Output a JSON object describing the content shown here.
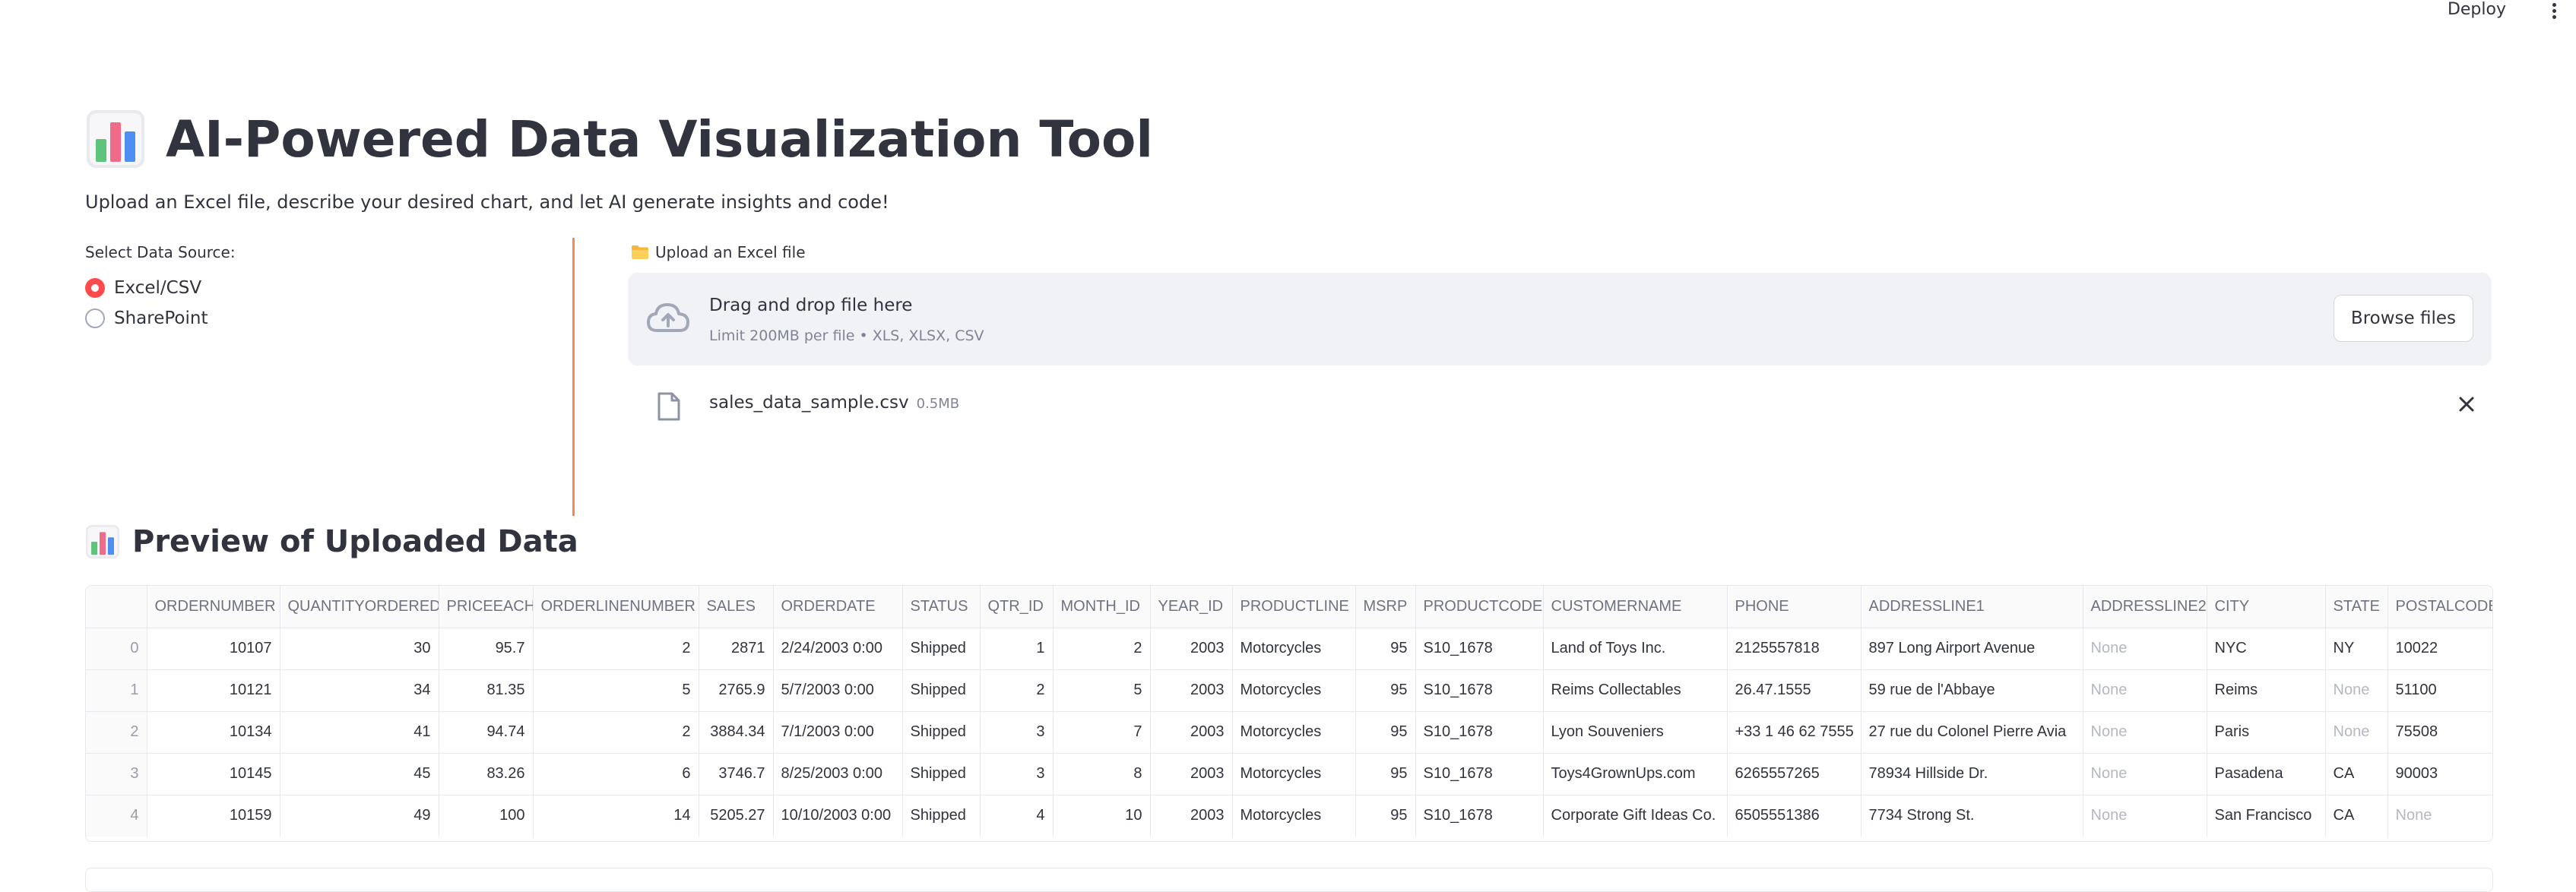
{
  "header": {
    "deploy_label": "Deploy"
  },
  "page": {
    "title": "AI-Powered Data Visualization Tool",
    "subtitle": "Upload an Excel file, describe your desired chart, and let AI generate insights and code!"
  },
  "data_source": {
    "label": "Select Data Source:",
    "options": [
      {
        "label": "Excel/CSV",
        "selected": true
      },
      {
        "label": "SharePoint",
        "selected": false
      }
    ]
  },
  "uploader": {
    "label": "Upload an Excel file",
    "drop_title": "Drag and drop file here",
    "drop_limit": "Limit 200MB per file • XLS, XLSX, CSV",
    "browse_label": "Browse files",
    "file": {
      "name": "sales_data_sample.csv",
      "size": "0.5MB"
    }
  },
  "preview": {
    "title": "Preview of Uploaded Data",
    "columns": [
      "",
      "ORDERNUMBER",
      "QUANTITYORDERED",
      "PRICEEACH",
      "ORDERLINENUMBER",
      "SALES",
      "ORDERDATE",
      "STATUS",
      "QTR_ID",
      "MONTH_ID",
      "YEAR_ID",
      "PRODUCTLINE",
      "MSRP",
      "PRODUCTCODE",
      "CUSTOMERNAME",
      "PHONE",
      "ADDRESSLINE1",
      "ADDRESSLINE2",
      "CITY",
      "STATE",
      "POSTALCODE"
    ],
    "rows": [
      [
        "0",
        "10107",
        "30",
        "95.7",
        "2",
        "2871",
        "2/24/2003 0:00",
        "Shipped",
        "1",
        "2",
        "2003",
        "Motorcycles",
        "95",
        "S10_1678",
        "Land of Toys Inc.",
        "2125557818",
        "897 Long Airport Avenue",
        "None",
        "NYC",
        "NY",
        "10022"
      ],
      [
        "1",
        "10121",
        "34",
        "81.35",
        "5",
        "2765.9",
        "5/7/2003 0:00",
        "Shipped",
        "2",
        "5",
        "2003",
        "Motorcycles",
        "95",
        "S10_1678",
        "Reims Collectables",
        "26.47.1555",
        "59 rue de l'Abbaye",
        "None",
        "Reims",
        "None",
        "51100"
      ],
      [
        "2",
        "10134",
        "41",
        "94.74",
        "2",
        "3884.34",
        "7/1/2003 0:00",
        "Shipped",
        "3",
        "7",
        "2003",
        "Motorcycles",
        "95",
        "S10_1678",
        "Lyon Souveniers",
        "+33 1 46 62 7555",
        "27 rue du Colonel Pierre Avia",
        "None",
        "Paris",
        "None",
        "75508"
      ],
      [
        "3",
        "10145",
        "45",
        "83.26",
        "6",
        "3746.7",
        "8/25/2003 0:00",
        "Shipped",
        "3",
        "8",
        "2003",
        "Motorcycles",
        "95",
        "S10_1678",
        "Toys4GrownUps.com",
        "6265557265",
        "78934 Hillside Dr.",
        "None",
        "Pasadena",
        "CA",
        "90003"
      ],
      [
        "4",
        "10159",
        "49",
        "100",
        "14",
        "5205.27",
        "10/10/2003 0:00",
        "Shipped",
        "4",
        "10",
        "2003",
        "Motorcycles",
        "95",
        "S10_1678",
        "Corporate Gift Ideas Co.",
        "6505551386",
        "7734 Strong St.",
        "None",
        "San Francisco",
        "CA",
        "None"
      ]
    ],
    "numeric_columns": [
      0,
      1,
      2,
      3,
      4,
      5,
      8,
      9,
      10,
      12
    ]
  }
}
